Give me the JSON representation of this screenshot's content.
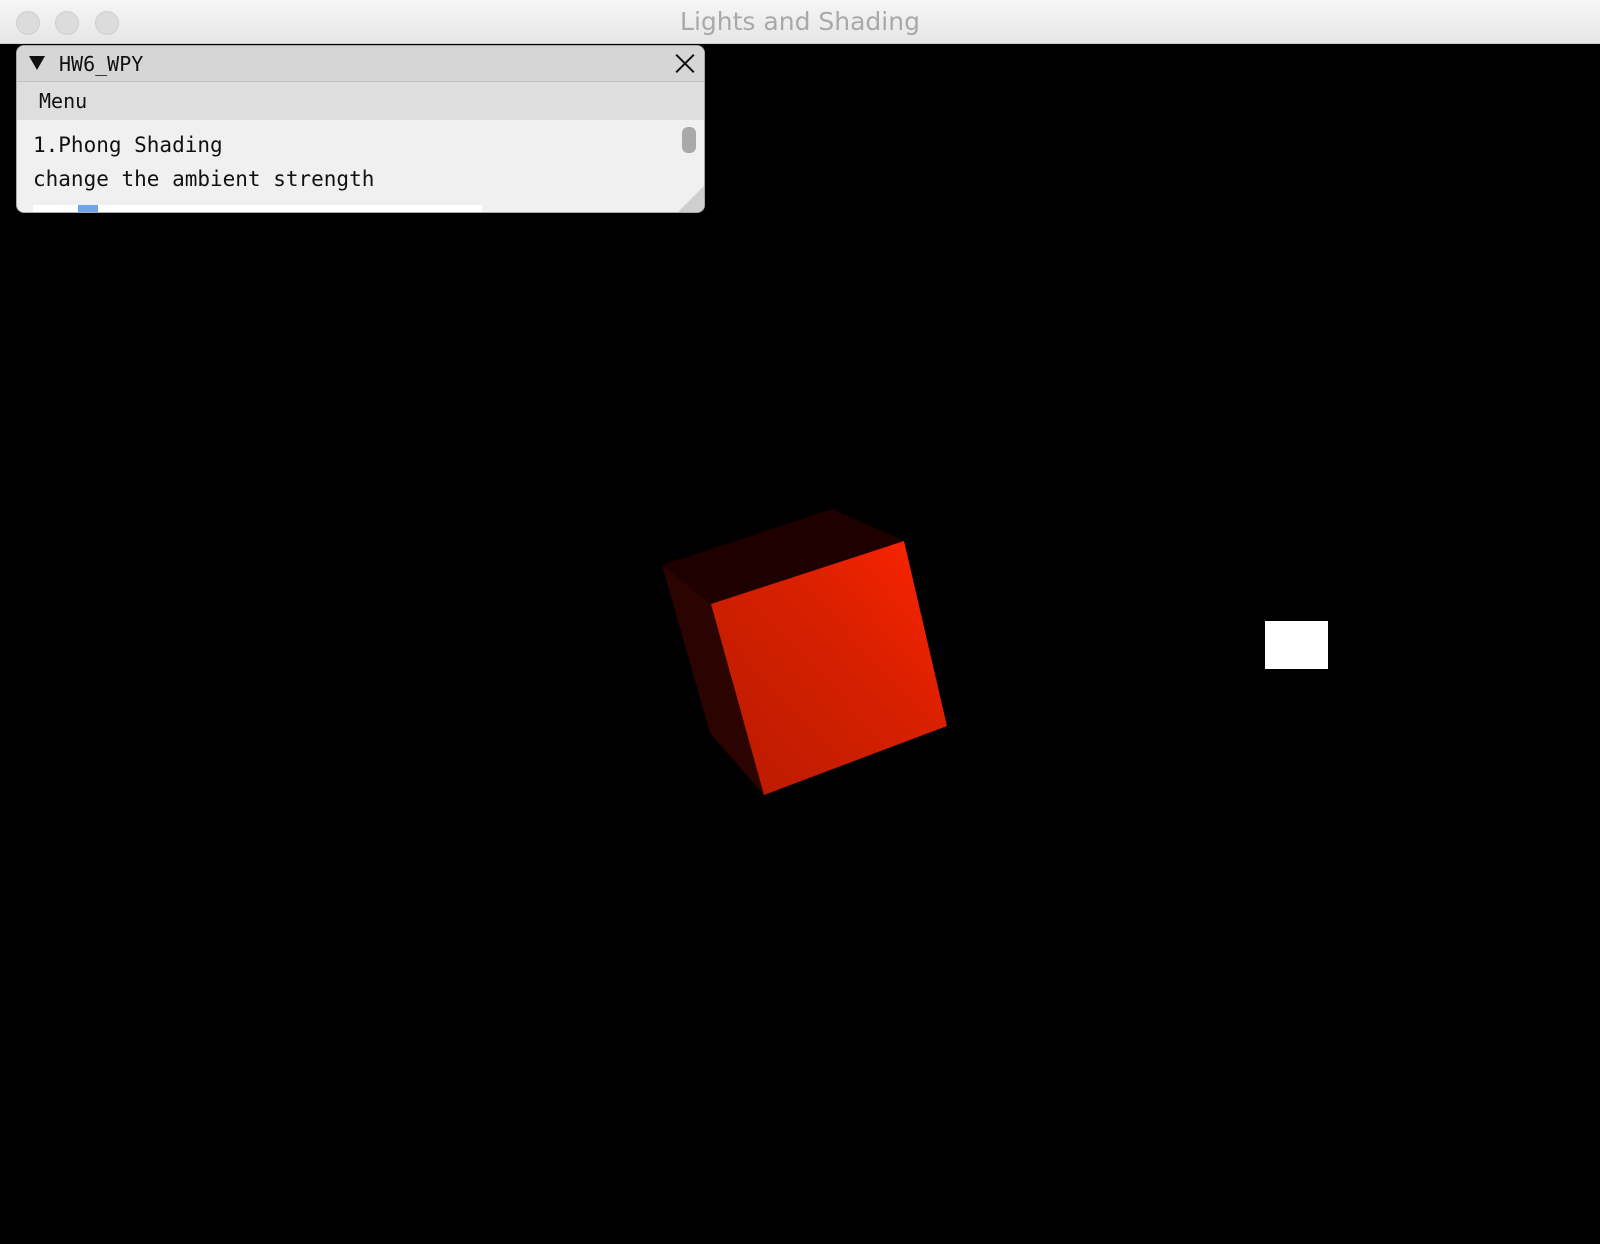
{
  "window": {
    "title": "Lights and Shading"
  },
  "panel": {
    "title": "HW6_WPY",
    "menu_label": "Menu",
    "lines": [
      "1.Phong Shading",
      "change the ambient strength"
    ],
    "ambient_slider": {
      "value_fraction": 0.1
    }
  },
  "scene": {
    "object": "cube",
    "object_color": "#ff2200",
    "light_color": "#ffffff",
    "background": "#000000"
  }
}
